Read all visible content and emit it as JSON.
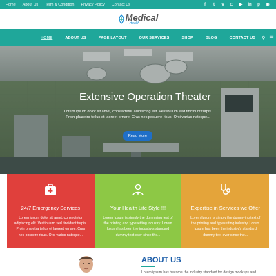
{
  "topbar": {
    "links": [
      "Home",
      "About Us",
      "Term & Condition",
      "Privacy Policy",
      "Contact Us"
    ],
    "social_icons": [
      "facebook-icon",
      "twitter-icon",
      "vimeo-icon",
      "instagram-icon",
      "youtube-icon",
      "linkedin-icon",
      "pinterest-icon",
      "rss-icon"
    ]
  },
  "logo": {
    "main": "Medical",
    "sub": "Health"
  },
  "nav": {
    "items": [
      "HOME",
      "ABOUT US",
      "PAGE LAYOUT",
      "OUR SERVICES",
      "SHOP",
      "BLOG",
      "CONTACT US"
    ],
    "active": "HOME"
  },
  "hero": {
    "title": "Extensive Operation Theater",
    "text_line1": "Lorem ipsum dolor sit amet, consectetur adipiscing elit. Vestibulum sed tincidunt turpis.",
    "text_line2": "Proin pharetra tellus et laoreet ornare. Cras nec posuere risus. Orci varius natoque...",
    "button": "Read More"
  },
  "features": [
    {
      "title": "24/7 Emergency Services",
      "text": "Lorem ipsum dolor sit amet, consectetur adipiscing elit. Vestibulum sed tincidunt turpis. Proin pharetra tellus et laoreet ornare. Cras nec posuere risus. Orci varius natoque...",
      "color": "#e0403c",
      "icon": "first-aid-kit-icon"
    },
    {
      "title": "Your Health Life Style !!!",
      "text": "Lorem Ipsum is simply the dummying text of the printing and typesetting industry. Lorem Ipsum has been the industry's standard dummy text ever since the...",
      "color": "#8dc845",
      "icon": "doctor-icon"
    },
    {
      "title": "Expertise in Services we Offer",
      "text": "Lorem Ipsum is simply the dummying text of the printing and typesetting industry. Lorem Ipsum has been the industry's standard dummy text ever since the...",
      "color": "#e4a43a",
      "icon": "stethoscope-icon"
    }
  ],
  "about": {
    "title": "ABOUT US",
    "text": "Lorem ipsum has become the industry standard for design mockups and"
  }
}
